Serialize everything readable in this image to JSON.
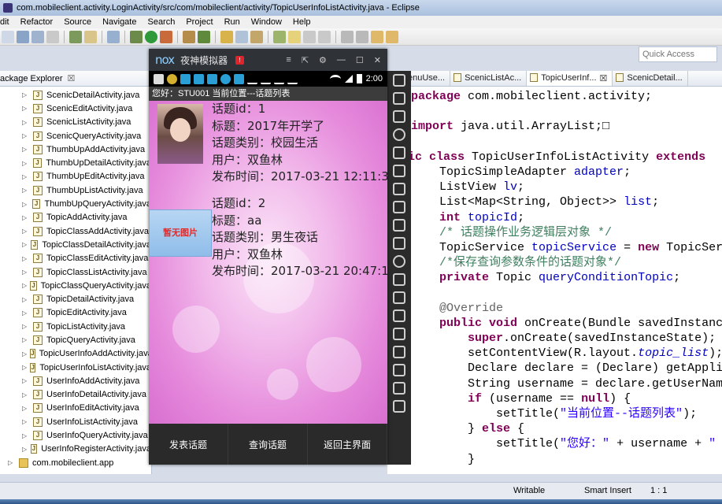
{
  "window": {
    "title": "com.mobileclient.activity.LoginActivity/src/com/mobileclient/activity/TopicUserInfoListActivity.java - Eclipse"
  },
  "menu": [
    "dit",
    "Refactor",
    "Source",
    "Navigate",
    "Search",
    "Project",
    "Run",
    "Window",
    "Help"
  ],
  "quick_access": {
    "placeholder": "Quick Access"
  },
  "explorer": {
    "tab_label": "ackage Explorer",
    "close_glyph": "☒",
    "files": [
      "ScenicDetailActivity.java",
      "ScenicEditActivity.java",
      "ScenicListActivity.java",
      "ScenicQueryActivity.java",
      "ThumbUpAddActivity.java",
      "ThumbUpDetailActivity.java",
      "ThumbUpEditActivity.java",
      "ThumbUpListActivity.java",
      "ThumbUpQueryActivity.java",
      "TopicAddActivity.java",
      "TopicClassAddActivity.java",
      "TopicClassDetailActivity.java",
      "TopicClassEditActivity.java",
      "TopicClassListActivity.java",
      "TopicClassQueryActivity.java",
      "TopicDetailActivity.java",
      "TopicEditActivity.java",
      "TopicListActivity.java",
      "TopicQueryActivity.java",
      "TopicUserInfoAddActivity.java",
      "TopicUserInfoListActivity.java",
      "UserInfoAddActivity.java",
      "UserInfoDetailActivity.java",
      "UserInfoEditActivity.java",
      "UserInfoListActivity.java",
      "UserInfoQueryActivity.java",
      "UserInfoRegisterActivity.java"
    ],
    "package": "com.mobileclient.app"
  },
  "editor_tabs": [
    "enuUse...",
    "ScenicListAc...",
    "TopicUserInf...",
    "ScenicDetail..."
  ],
  "editor_tabs_close": "☒",
  "code": {
    "l1_kw": "package",
    "l1_rest": " com.mobileclient.activity;",
    "l2_kw": "import",
    "l2_rest": " java.util.ArrayList;",
    "l2_fold": "□",
    "l3_a": "blic ",
    "l3_kw": "class",
    "l3_mid": " TopicUserInfoListActivity ",
    "l3_kw2": "extends",
    "l4_type": "TopicSimpleAdapter ",
    "l4_fld": "adapter",
    "l4_end": ";",
    "l5_type": "ListView ",
    "l5_fld": "lv",
    "l5_end": ";",
    "l6_type": "List<Map<String, Object>> ",
    "l6_fld": "list",
    "l6_end": ";",
    "l7_kw": "int",
    "l7_sp": " ",
    "l7_fld": "topicId",
    "l7_end": ";",
    "l8_cm": "/* 话题操作业务逻辑层对象 */",
    "l9_type": "TopicService ",
    "l9_fld": "topicService",
    "l9_mid": " = ",
    "l9_kw": "new",
    "l9_rest": " TopicServic",
    "l10_cm": "/*保存查询参数条件的话题对象*/",
    "l11_kw": "private",
    "l11_type": " Topic ",
    "l11_fld": "queryConditionTopic",
    "l11_end": ";",
    "l12_an": "@Override",
    "l13_kw": "public",
    "l13_kw2": " void",
    "l13_rest": " onCreate(Bundle savedInstanceS",
    "l14_kw": "super",
    "l14_rest": ".onCreate(savedInstanceState);",
    "l15_a": "setContentView(R.layout.",
    "l15_it": "topic_list",
    "l15_end": ");",
    "l16": "Declare declare = (Declare) getApplica",
    "l17": "String username = declare.getUserName(",
    "l18_kw": "if",
    "l18_a": " (username == ",
    "l18_kw2": "null",
    "l18_b": ") {",
    "l19_a": "setTitle(",
    "l19_st": "\"当前位置--话题列表\"",
    "l19_b": ");",
    "l20_a": "} ",
    "l20_kw": "else",
    "l20_b": " {",
    "l21_a": "setTitle(",
    "l21_st": "\"您好：\"",
    "l21_b": " + username + ",
    "l21_st2": "\"",
    "l22": "}"
  },
  "emulator": {
    "logo": "nox",
    "title": "夜神模拟器",
    "badge": "!",
    "controls": [
      "≡",
      "⇱",
      "⚙",
      "—",
      "☐",
      "✕"
    ],
    "clock": "2:00",
    "activity_title": "您好：STU001  当前位置---话题列表",
    "items": [
      {
        "lines": [
          "话题id：1",
          "标题：2017年开学了",
          "话题类别：校园生活",
          "用户：双鱼林",
          "发布时间：2017-03-21 12:11:33"
        ],
        "image": "avatar"
      },
      {
        "lines": [
          "话题id：2",
          "标题：aa",
          "话题类别：男生夜话",
          "用户：双鱼林",
          "发布时间：2017-03-21 20:47:13"
        ],
        "image": "暂无图片"
      }
    ],
    "buttons": [
      "发表话题",
      "查询话题",
      "返回主界面"
    ]
  },
  "status": {
    "writable": "Writable",
    "insert_mode": "Smart Insert",
    "position": "1 : 1"
  }
}
